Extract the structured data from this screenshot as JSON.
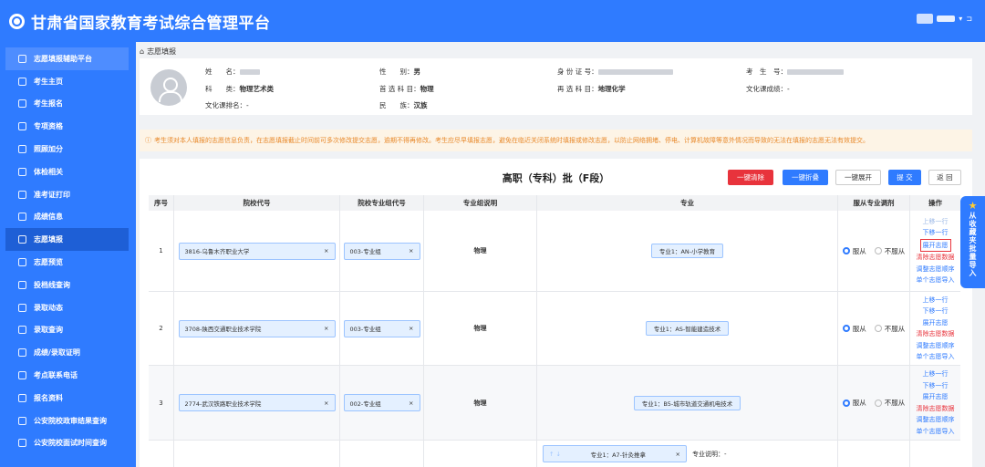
{
  "app": {
    "title": "甘肃省国家教育考试综合管理平台"
  },
  "sidebar": {
    "items": [
      {
        "label": "志愿填报辅助平台"
      },
      {
        "label": "考生主页"
      },
      {
        "label": "考生报名"
      },
      {
        "label": "专项资格"
      },
      {
        "label": "照顾加分"
      },
      {
        "label": "体检相关"
      },
      {
        "label": "准考证打印"
      },
      {
        "label": "成绩信息"
      },
      {
        "label": "志愿填报"
      },
      {
        "label": "志愿预览"
      },
      {
        "label": "投档线查询"
      },
      {
        "label": "录取动态"
      },
      {
        "label": "录取查询"
      },
      {
        "label": "成绩/录取证明"
      },
      {
        "label": "考点联系电话"
      },
      {
        "label": "报名资料"
      },
      {
        "label": "公安院校政审结果查询"
      },
      {
        "label": "公安院校面试时间查询"
      }
    ]
  },
  "breadcrumb": {
    "home_icon": "home-icon",
    "label": "志愿填报"
  },
  "profile": {
    "name_label": "姓　　名：",
    "subject_type_label": "科　　类：",
    "subject_type": "物理艺术类",
    "culture_rank_label": "文化课排名：",
    "culture_rank": "-",
    "gender_label": "性　　别：",
    "gender": "男",
    "first_subject_label": "首 选 科 目：",
    "first_subject": "物理",
    "nation_label": "民　　族：",
    "nation": "汉族",
    "id_label": "身 份 证 号：",
    "second_subject_label": "再 选 科 目：",
    "second_subject": "地理化学",
    "exam_no_label": "考　生　号：",
    "culture_score_label": "文化课成绩：",
    "culture_score": "-"
  },
  "notice": "考生须对本人填报的志愿信息负责，在志愿填报截止时间前可多次修改提交志愿，逾期不得再修改。考生应尽早填报志愿，避免在临近关闭系统时填报或修改志愿，以防止网络拥堵、停电、计算机故障等意外情况而导致的无法在填报的志愿无法有效提交。",
  "panel": {
    "title": "高职（专科）批（F段）",
    "buttons": {
      "clear": "一键清除",
      "collapse": "一键折叠",
      "expand": "一键展开",
      "submit": "提 交",
      "back": "返 回"
    }
  },
  "table": {
    "headers": [
      "序号",
      "院校代号",
      "院校专业组代号",
      "专业组说明",
      "专业",
      "服从专业调剂",
      "操作"
    ],
    "rows": [
      {
        "no": "1",
        "school": "3816-乌鲁木齐职业大学",
        "group": "003-专业组",
        "desc": "物理",
        "major": "专业1：AN-小学教育",
        "obey": "服从",
        "not_obey": "不服从"
      },
      {
        "no": "2",
        "school": "3708-陕西交通职业技术学院",
        "group": "003-专业组",
        "desc": "物理",
        "major": "专业1：AS-智能建造技术",
        "obey": "服从",
        "not_obey": "不服从"
      },
      {
        "no": "3",
        "school": "2774-武汉铁路职业技术学院",
        "group": "002-专业组",
        "desc": "物理",
        "major": "专业1：B5-城市轨道交通机电技术",
        "obey": "服从",
        "not_obey": "不服从"
      }
    ],
    "ops": {
      "up": "上移一行",
      "down": "下移一行",
      "expand": "展开志愿",
      "clear": "清除志愿数据",
      "adjust": "调整志愿顺序",
      "import": "单个志愿导入"
    },
    "partial_row": {
      "major": "专业1：A7-针灸推拿",
      "major_desc": "专业说明：-"
    }
  },
  "float_btn": {
    "label": "从收藏夹批量导入"
  }
}
